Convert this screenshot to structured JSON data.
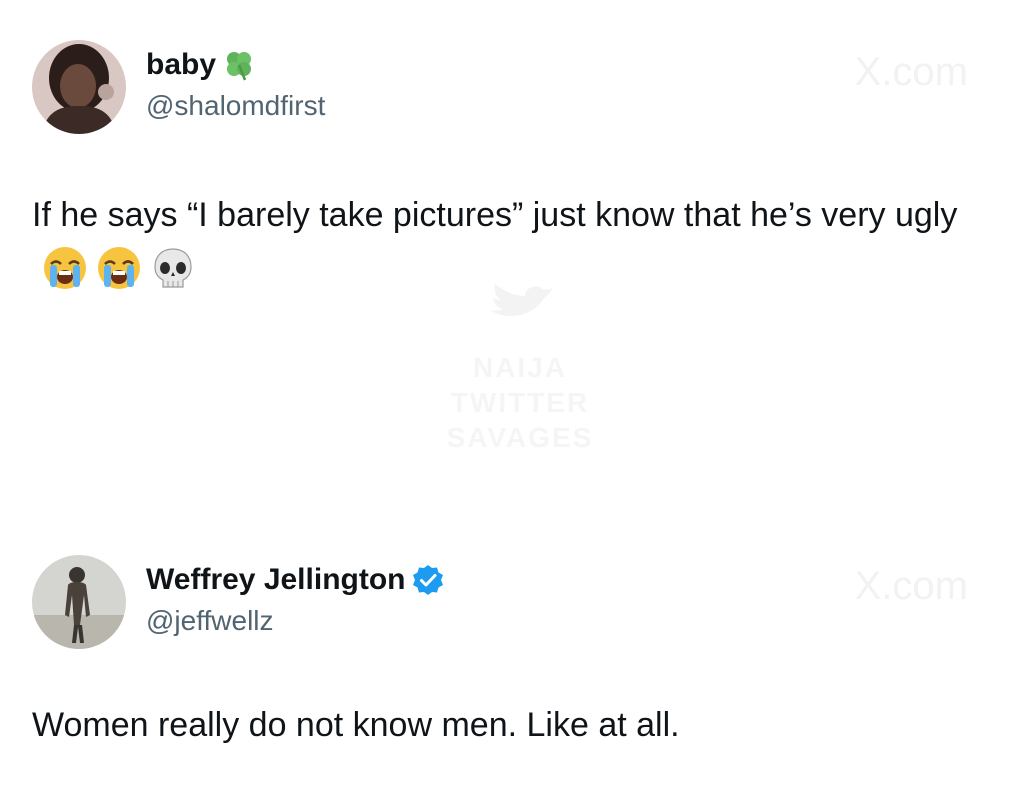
{
  "tweets": [
    {
      "display_name": "baby",
      "name_badge_icon": "four-leaf-clover-icon",
      "handle": "@shalomdfirst",
      "text": "If he says “I barely take pictures” just know that he’s very ugly",
      "emojis": [
        "loudly-crying-face-icon",
        "loudly-crying-face-icon",
        "skull-icon"
      ],
      "watermark": "X.com"
    },
    {
      "display_name": "Weffrey Jellington",
      "name_badge_icon": "verified-badge-icon",
      "handle": "@jeffwellz",
      "text": "Women really do not know men. Like at all.",
      "watermark": "X.com"
    }
  ],
  "center_watermark": {
    "lines": [
      "NAIJA",
      "TWITTER",
      "SAVAGES"
    ]
  },
  "colors": {
    "text_primary": "#0f1419",
    "text_secondary": "#536471",
    "verified_blue": "#1d9bf0",
    "clover_green": "#5fb35a"
  }
}
